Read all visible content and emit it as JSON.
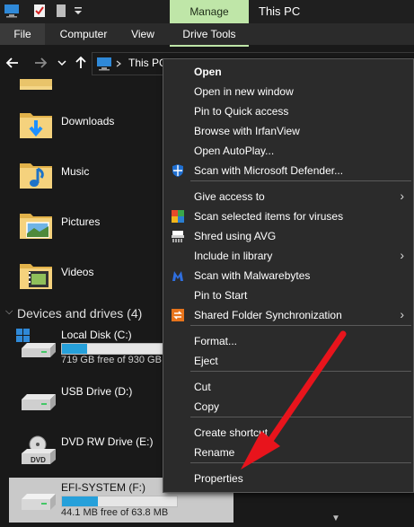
{
  "titlebar": {
    "manage_tab": "Manage",
    "title": "This PC"
  },
  "ribbon": {
    "file": "File",
    "computer": "Computer",
    "view": "View",
    "drive_tools": "Drive Tools"
  },
  "address": {
    "path": "This PC"
  },
  "folders": [
    {
      "label": "Downloads",
      "icon": "downloads-folder-icon"
    },
    {
      "label": "Music",
      "icon": "music-folder-icon"
    },
    {
      "label": "Pictures",
      "icon": "pictures-folder-icon"
    },
    {
      "label": "Videos",
      "icon": "videos-folder-icon"
    }
  ],
  "devices": {
    "header": "Devices and drives (4)",
    "drives": [
      {
        "name": "Local Disk (C:)",
        "free": "719 GB free of 930 GB",
        "used_fraction": 0.23
      },
      {
        "name": "USB Drive (D:)"
      },
      {
        "name": "DVD RW Drive (E:)",
        "icon_text": "DVD"
      },
      {
        "name": "EFI-SYSTEM (F:)",
        "free": "44.1 MB free of 63.8 MB",
        "used_fraction": 0.31
      }
    ]
  },
  "menu": {
    "items": [
      {
        "label": "Open",
        "bold": true
      },
      {
        "label": "Open in new window"
      },
      {
        "label": "Pin to Quick access"
      },
      {
        "label": "Browse with IrfanView"
      },
      {
        "label": "Open AutoPlay..."
      },
      {
        "label": "Scan with Microsoft Defender...",
        "icon": "defender-shield-icon"
      },
      {
        "label": "Give access to",
        "submenu": true
      },
      {
        "label": "Scan selected items for viruses",
        "icon": "avg-scan-icon"
      },
      {
        "label": "Shred using AVG",
        "icon": "shredder-icon"
      },
      {
        "label": "Include in library",
        "submenu": true
      },
      {
        "label": "Scan with Malwarebytes",
        "icon": "malwarebytes-icon"
      },
      {
        "label": "Pin to Start"
      },
      {
        "label": "Shared Folder Synchronization",
        "icon": "sync-icon",
        "submenu": true
      },
      {
        "label": "Format..."
      },
      {
        "label": "Eject"
      },
      {
        "label": "Cut"
      },
      {
        "label": "Copy"
      },
      {
        "label": "Create shortcut"
      },
      {
        "label": "Rename"
      },
      {
        "label": "Properties"
      }
    ],
    "submenu_glyph": "›"
  },
  "colors": {
    "accent_green": "#bfe6a8",
    "drive_bar": "#26a0da",
    "arrow_red": "#e8141c"
  }
}
